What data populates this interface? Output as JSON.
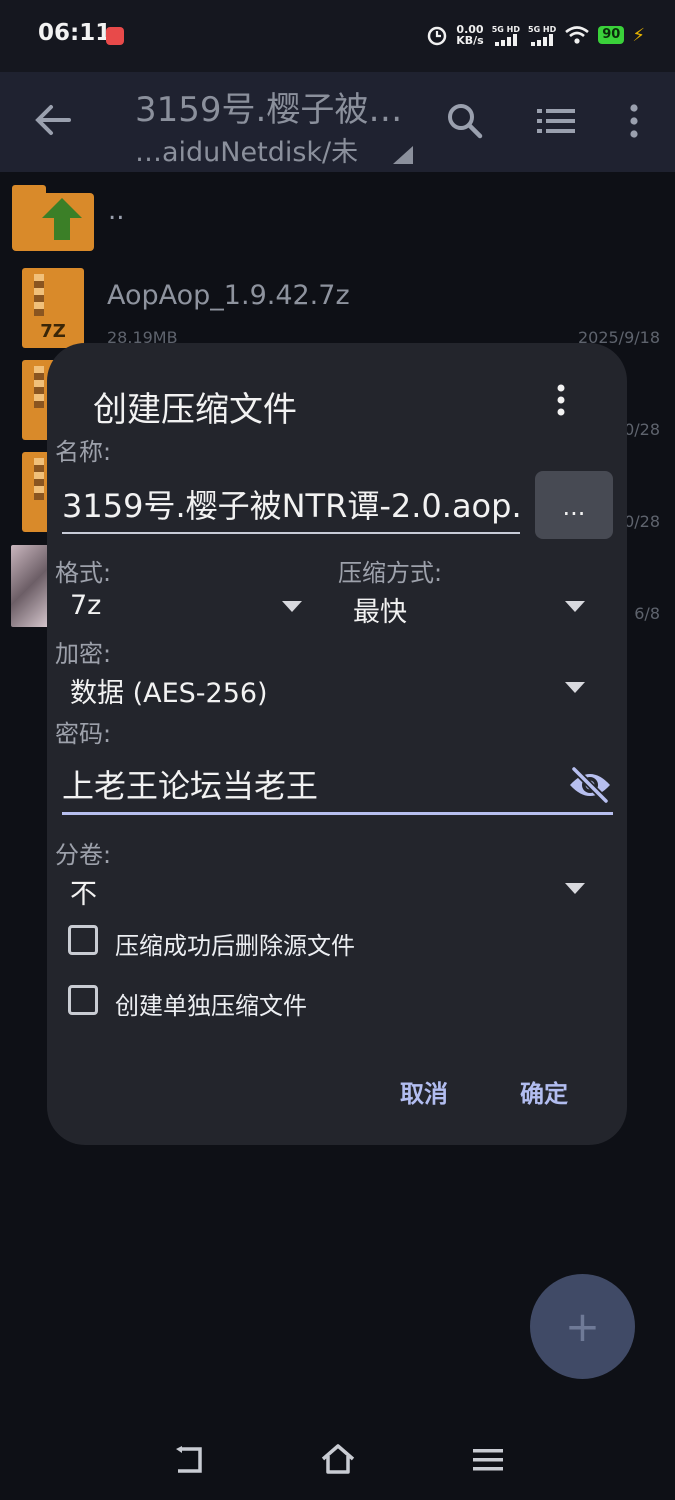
{
  "status_bar": {
    "time": "06:11",
    "net_speed_value": "0.00",
    "net_speed_unit": "KB/s",
    "sim1": "5G HD",
    "sim2": "5G HD",
    "battery": "90",
    "icons": [
      "app-badge-icon",
      "alarm-icon",
      "signal-icon",
      "wifi-icon",
      "battery-icon",
      "charging-icon"
    ]
  },
  "toolbar": {
    "title": "3159号.樱子被…",
    "path": "…aiduNetdisk/未",
    "icons": [
      "back-arrow-icon",
      "search-icon",
      "list-view-icon",
      "more-vert-icon"
    ]
  },
  "file_list": {
    "parent_label": "..",
    "items": [
      {
        "name": "AopAop_1.9.42.7z",
        "size": "28.19MB",
        "date": "2025/9/18",
        "icon_label": "7Z"
      },
      {
        "date": "0/28"
      },
      {
        "date": "0/28"
      },
      {
        "date": "6/8"
      }
    ]
  },
  "dialog": {
    "title": "创建压缩文件",
    "name_label": "名称:",
    "name_value": "3159号.樱子被NTR谭-2.0.aop.",
    "browse_label": "...",
    "format_label": "格式:",
    "format_value": "7z",
    "method_label": "压缩方式:",
    "method_value": "最快",
    "encrypt_label": "加密:",
    "encrypt_value": "数据 (AES-256)",
    "password_label": "密码:",
    "password_value": "上老王论坛当老王",
    "volume_label": "分卷:",
    "volume_value": "不",
    "checkbox_delete": "压缩成功后删除源文件",
    "checkbox_separate": "创建单独压缩文件",
    "cancel": "取消",
    "confirm": "确定"
  },
  "fab_label": "+",
  "colors": {
    "accent": "#b2bdf0",
    "dialog_bg": "#23252c",
    "page_bg": "#0e1016",
    "toolbar_bg": "#1f2230",
    "folder": "#d98a2a"
  }
}
